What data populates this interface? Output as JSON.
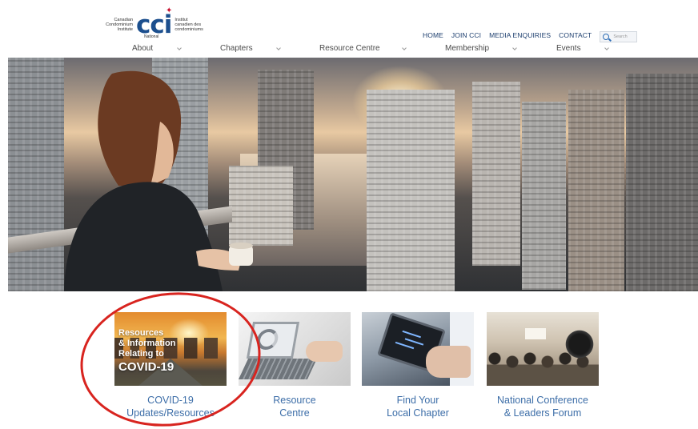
{
  "logo": {
    "english_name": "Canadian Condominium Institute",
    "mark": "CCI",
    "french_name": "Institut canadien des condominiums",
    "subtitle": "National"
  },
  "top_links": [
    "HOME",
    "JOIN CCI",
    "MEDIA ENQUIRIES",
    "CONTACT"
  ],
  "search": {
    "placeholder": "Search"
  },
  "main_nav": [
    "About",
    "Chapters",
    "Resource Centre",
    "Membership",
    "Events"
  ],
  "hero": {
    "description_icon": "city-skyline-image"
  },
  "tiles": [
    {
      "image_text_lines": [
        "Resources",
        "& Information",
        "Relating to"
      ],
      "image_text_big": "COVID-19",
      "caption_lines": [
        "COVID-19",
        "Updates/Resources"
      ],
      "highlighted": true
    },
    {
      "caption_lines": [
        "Resource",
        "Centre"
      ]
    },
    {
      "caption_lines": [
        "Find Your",
        "Local Chapter"
      ]
    },
    {
      "caption_lines": [
        "National Conference",
        "& Leaders Forum"
      ]
    }
  ],
  "colors": {
    "brand_blue": "#1c4f8e",
    "link_blue": "#3d6ea8",
    "annotation_red": "#d8241f",
    "leaf_red": "#c8102e"
  }
}
